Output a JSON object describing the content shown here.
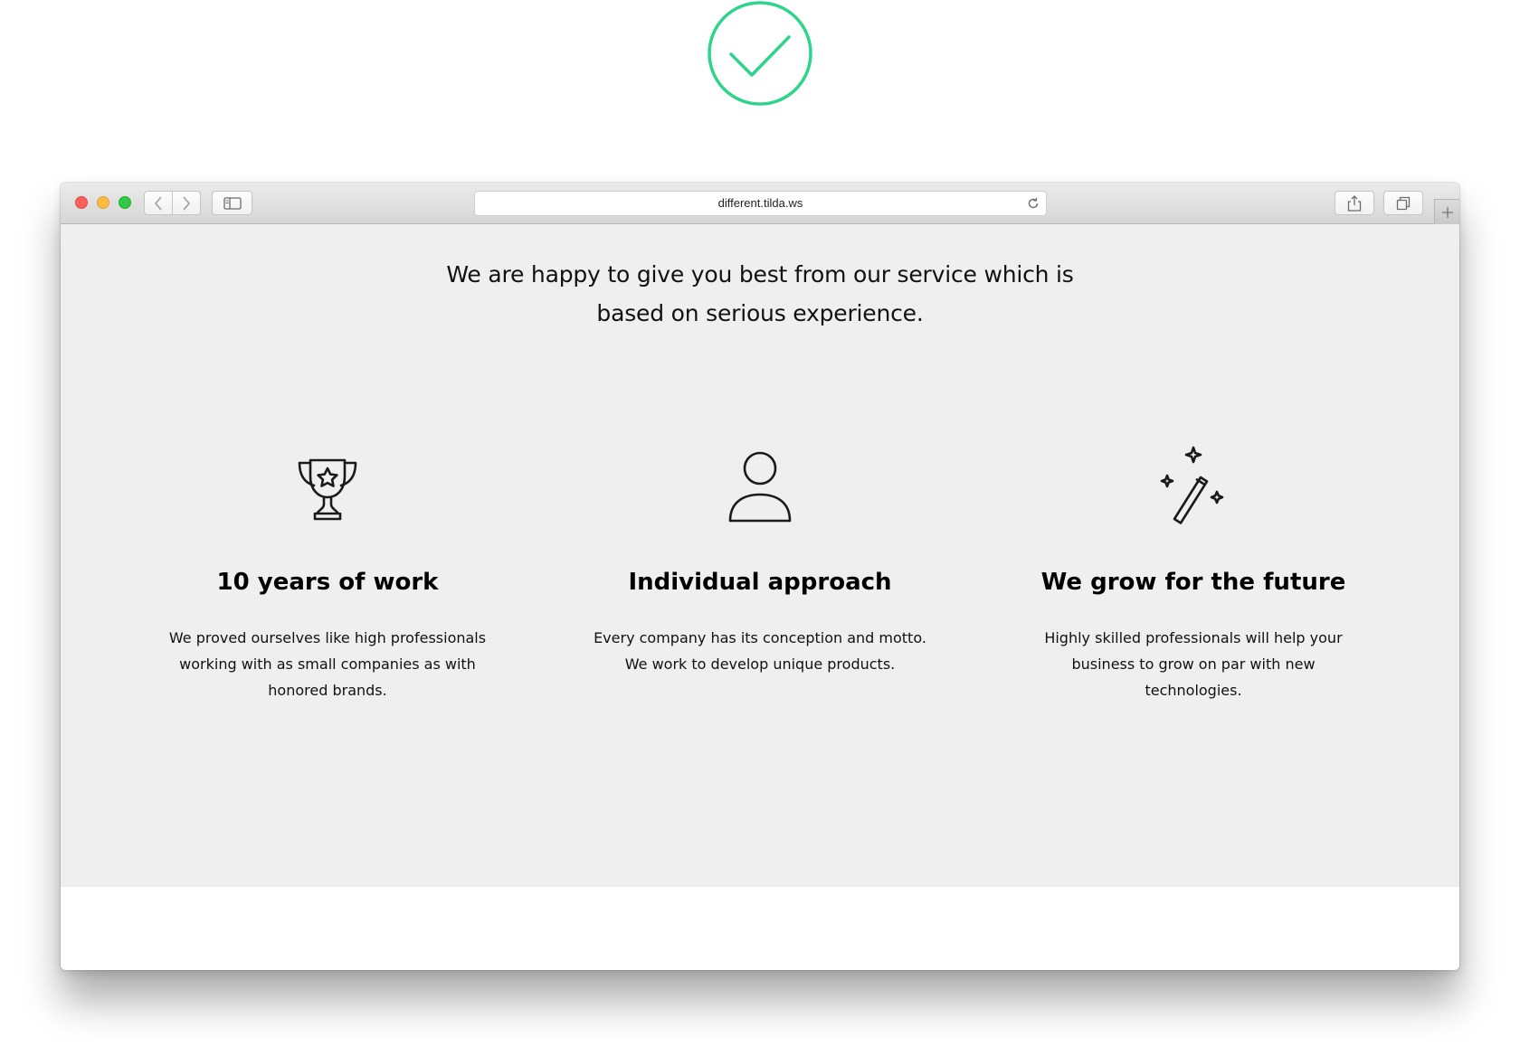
{
  "colors": {
    "accent_check": "#2fd48b",
    "content_bg": "#efefef",
    "text": "#000000"
  },
  "browser": {
    "url": "different.tilda.ws",
    "icons": [
      "back-icon",
      "forward-icon",
      "sidebar-icon",
      "reload-icon",
      "share-icon",
      "tabs-icon",
      "plus-icon"
    ]
  },
  "page": {
    "intro": "We are happy to give you best from our service which is based on serious experience.",
    "features": [
      {
        "icon": "trophy-icon",
        "title": "10 years of work",
        "text": "We proved ourselves like high professionals working with as small companies as with honored brands."
      },
      {
        "icon": "person-icon",
        "title": "Individual approach",
        "text": "Every company has its conception and motto. We work to develop unique products."
      },
      {
        "icon": "magic-wand-icon",
        "title": "We grow for the future",
        "text": "Highly skilled professionals will help your business to grow on par with new technologies."
      }
    ]
  }
}
